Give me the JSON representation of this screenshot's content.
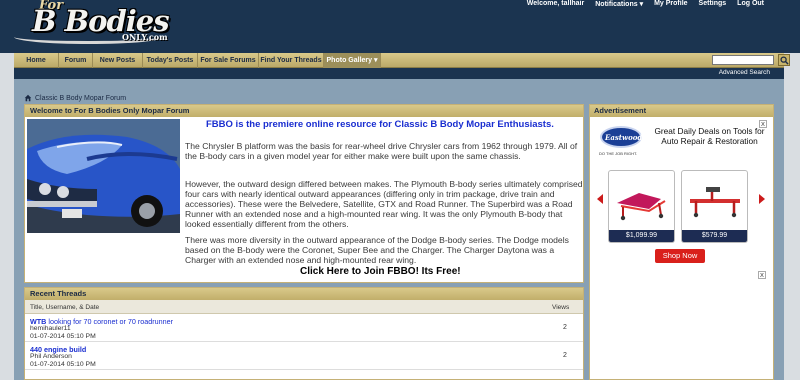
{
  "logo": {
    "line1": "For",
    "line2": "B Bodies",
    "line3": "ONLY.com"
  },
  "toplinks": {
    "welcome": "Welcome, tallhair",
    "notifications": "Notifications ▾",
    "my_profile": "My Profile",
    "settings": "Settings",
    "logout": "Log Out"
  },
  "nav": {
    "items": [
      "Home",
      "Forum",
      "New Posts",
      "Today's Posts",
      "For Sale Forums",
      "Find Your Threads",
      "Photo Gallery ▾"
    ]
  },
  "advanced_search": "Advanced Search",
  "breadcrumb": "Classic B Body Mopar Forum",
  "welcome_box": {
    "header": "Welcome to For B Bodies Only Mopar Forum",
    "title": "FBBO is the premiere online resource for Classic B Body Mopar Enthusiasts.",
    "p1": "The Chrysler B platform was the basis for rear-wheel drive Chrysler cars from 1962 through 1979. All of the B-body cars in a given model year for either make were built upon the same chassis.",
    "p2": "However, the outward design differed between makes. The Plymouth B-body series ultimately comprised four cars with nearly identical outward appearances (differing only in trim package, drive train and accessories). These were the Belvedere, Satellite, GTX and Road Runner. The Superbird was a Road Runner with an extended nose and a high-mounted rear wing. It was the only Plymouth B-body that looked essentially different from the others.",
    "p3": "There was more diversity in the outward appearance of the Dodge B-body series. The Dodge models based on the B-body were the Coronet, Super Bee and the Charger. The Charger Daytona was a Charger with an extended nose and high-mounted rear wing.",
    "join": "Click Here to Join FBBO! Its Free!"
  },
  "ad_box": {
    "header": "Advertisement",
    "brand": "Eastwood",
    "brand_tag": "DO THE JOB RIGHT.",
    "text": "Great Daily Deals on Tools for Auto Repair & Restoration",
    "prices": [
      "$1,099.99",
      "$579.99"
    ],
    "shop_now": "Shop Now",
    "close": "x"
  },
  "recent_threads": {
    "header": "Recent Threads",
    "col_title": "Title, Username, & Date",
    "col_views": "Views",
    "threads": [
      {
        "prefix": "WTB",
        "title": "looking for 70 coronet or 70 roadrunner",
        "user": "hemihauler11",
        "date": "01-07-2014 05:10 PM",
        "views": "2"
      },
      {
        "prefix": "",
        "title": "440 engine build",
        "user": "Phil Anderson",
        "date": "01-07-2014 05:10 PM",
        "views": "2"
      }
    ]
  },
  "colors": {
    "header_bg": "#1b3450",
    "nav_gold": "#d9c98a",
    "link_blue": "#1a2ed0",
    "main_bg": "#88a0b4",
    "ad_red": "#d9201b"
  },
  "icons": [
    "home-icon",
    "search-icon",
    "close-icon",
    "arrow-left-icon",
    "arrow-right-icon"
  ]
}
